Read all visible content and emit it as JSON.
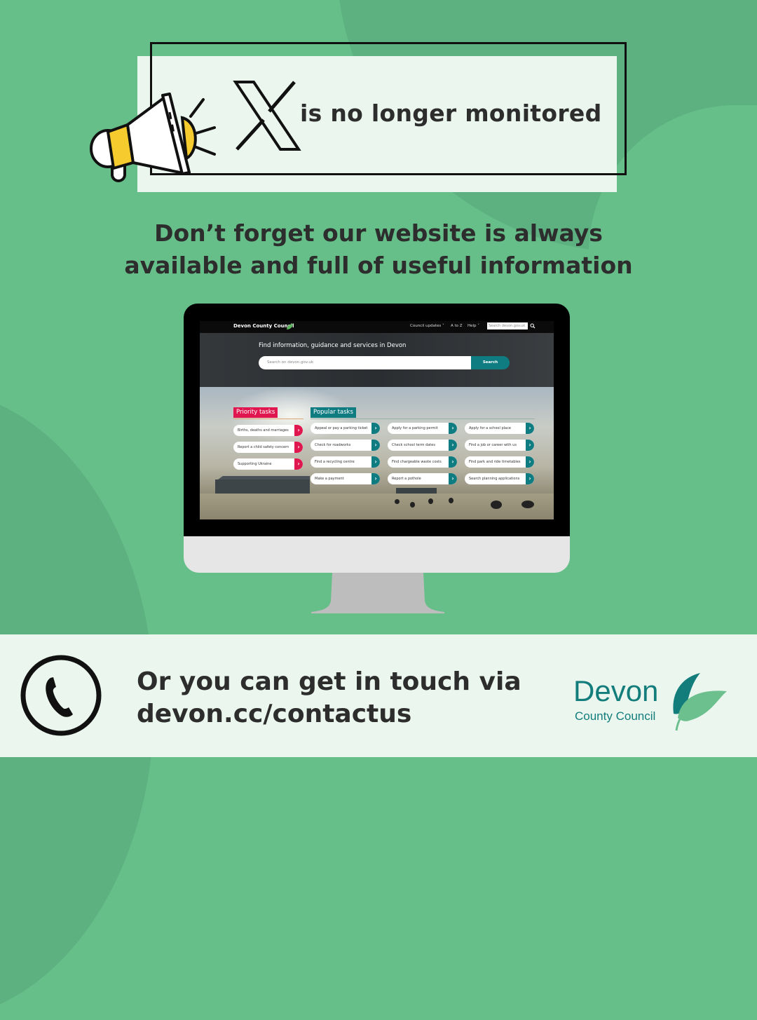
{
  "headline": {
    "brand_icon": "x-logo-icon",
    "text": "is no longer monitored"
  },
  "subheadline": {
    "line1": "Don’t forget our website is always",
    "line2": "available and full of useful information"
  },
  "website": {
    "brand": "Devon County Council",
    "nav": {
      "council_updates": "Council updates",
      "a_to_z": "A to Z",
      "help": "Help",
      "search_placeholder": "Search devon.gov.uk"
    },
    "hero": {
      "title": "Find information, guidance and services in Devon",
      "search_placeholder": "Search on devon.gov.uk",
      "search_button": "Search"
    },
    "priority_tasks": {
      "heading": "Priority tasks",
      "items": [
        {
          "label": "Births, deaths and marriages"
        },
        {
          "label": "Report a child safety concern"
        },
        {
          "label": "Supporting Ukraine"
        }
      ]
    },
    "popular_tasks": {
      "heading": "Popular tasks",
      "columns": [
        [
          {
            "label": "Appeal or pay a parking ticket"
          },
          {
            "label": "Check for roadworks"
          },
          {
            "label": "Find a recycling centre"
          },
          {
            "label": "Make a payment"
          }
        ],
        [
          {
            "label": "Apply for a parking permit"
          },
          {
            "label": "Check school term dates"
          },
          {
            "label": "Find chargeable waste costs"
          },
          {
            "label": "Report a pothole"
          }
        ],
        [
          {
            "label": "Apply for a school place"
          },
          {
            "label": "Find a job or career with us"
          },
          {
            "label": "Find park and ride timetables"
          },
          {
            "label": "Search planning applications"
          }
        ]
      ]
    },
    "arrow_glyph": "›"
  },
  "footer": {
    "line1": "Or you can get in touch via",
    "line2": "devon.cc/contactus",
    "logo": {
      "word": "Devon",
      "sub": "County Council"
    }
  },
  "colors": {
    "background": "#66bf89",
    "background_shape": "#5db07f",
    "panel": "#ebf6ee",
    "text_dark": "#2d2d2d",
    "priority_red": "#e0174f",
    "popular_teal": "#0f7c82",
    "devon_teal": "#137d7b",
    "leaf_light": "#6cc08e",
    "megaphone_yellow": "#f5cb2e"
  }
}
